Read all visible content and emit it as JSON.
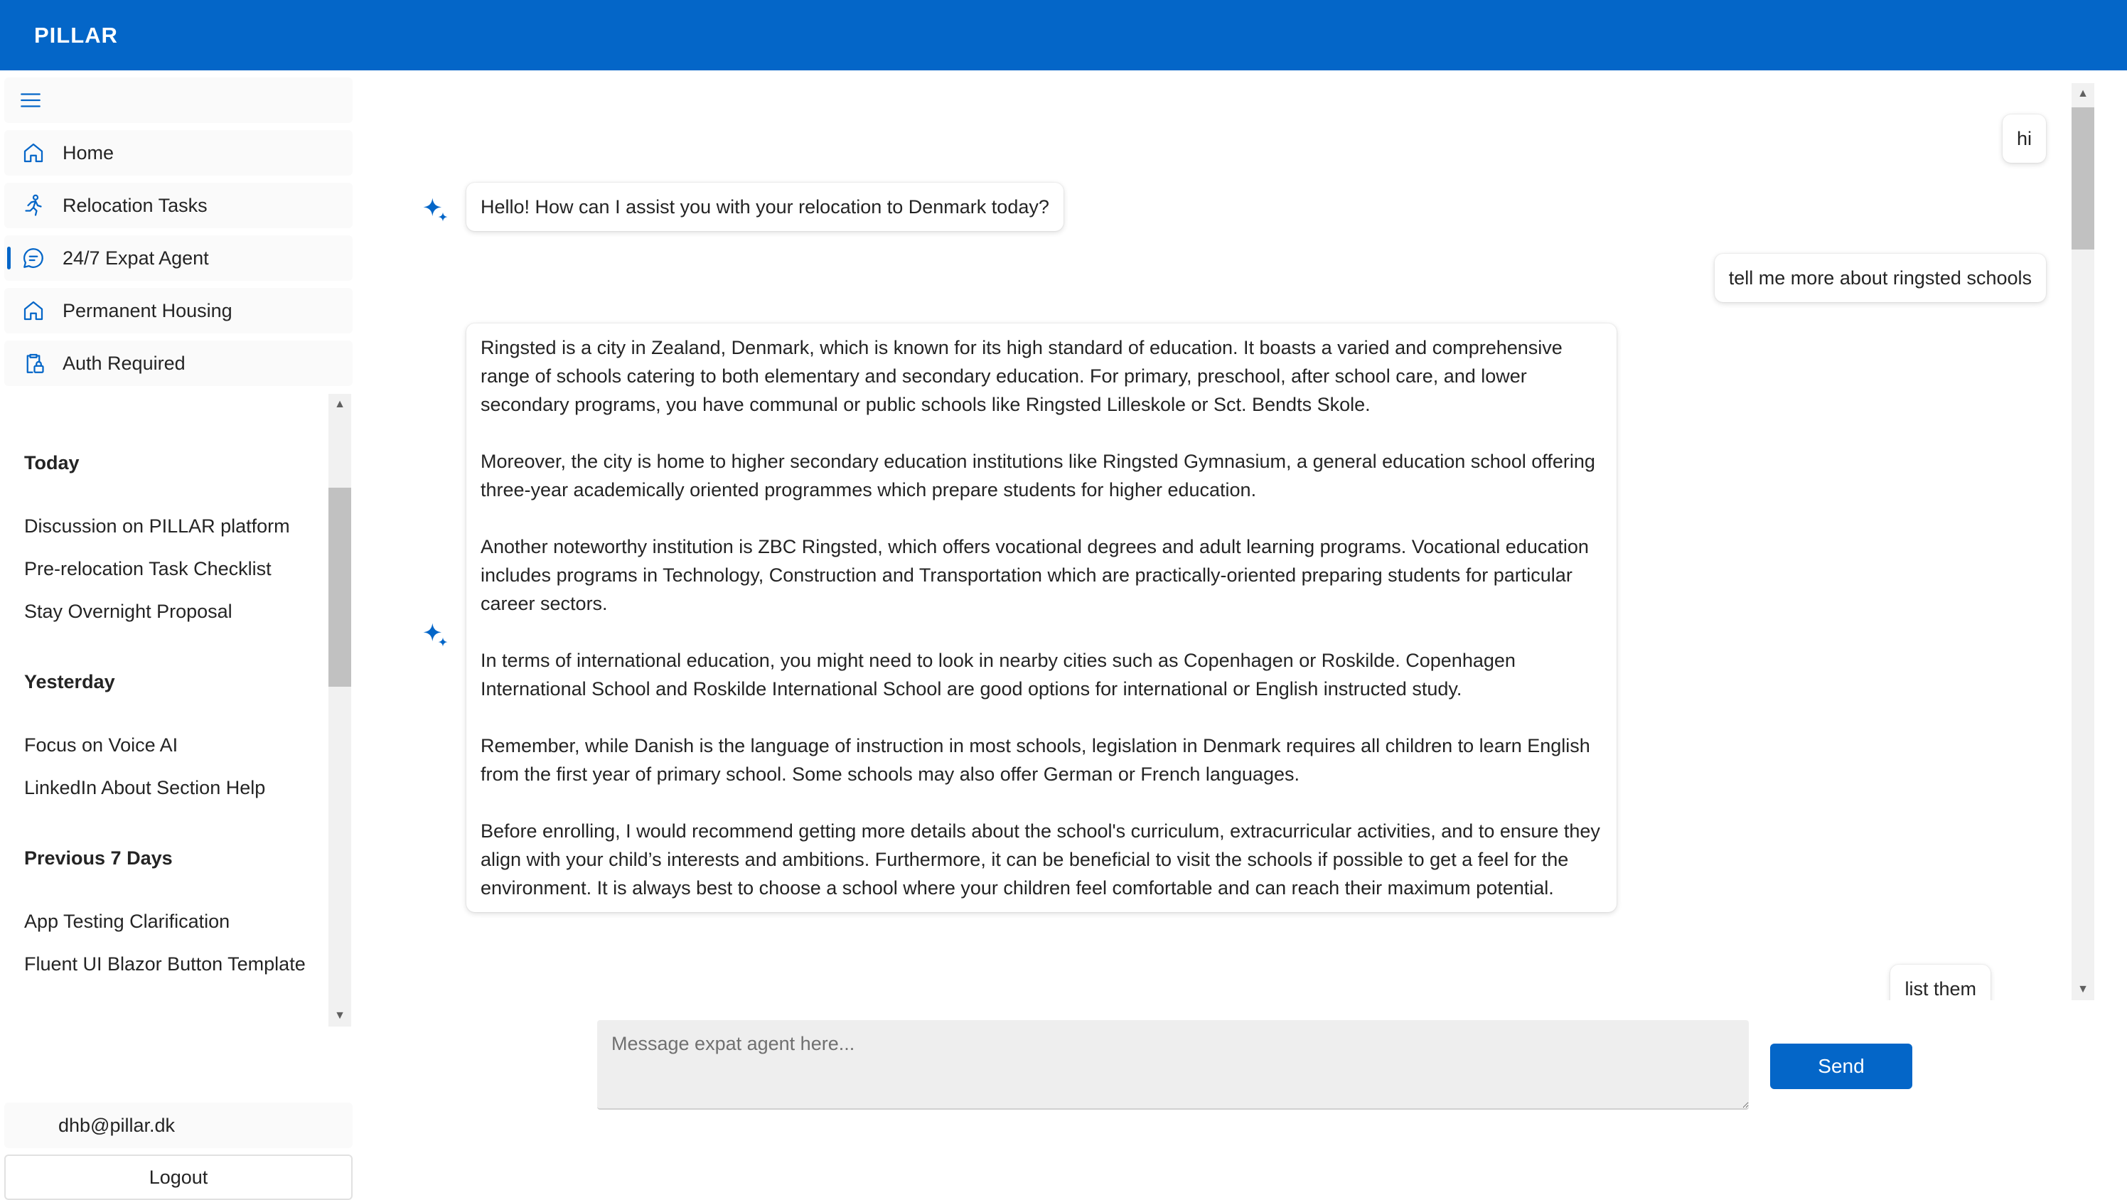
{
  "header": {
    "brand": "PILLAR"
  },
  "sidebar": {
    "menu_icon": "hamburger-menu-icon",
    "items": [
      {
        "label": "Home",
        "icon": "home-icon"
      },
      {
        "label": "Relocation Tasks",
        "icon": "person-running-icon"
      },
      {
        "label": "24/7 Expat Agent",
        "icon": "chat-bubble-icon",
        "active": true
      },
      {
        "label": "Permanent Housing",
        "icon": "home-icon"
      },
      {
        "label": "Auth Required",
        "icon": "clipboard-lock-icon"
      }
    ],
    "history": [
      {
        "group": "Today",
        "items": [
          "Discussion on PILLAR platform",
          "Pre-relocation Task Checklist",
          "Stay Overnight Proposal"
        ]
      },
      {
        "group": "Yesterday",
        "items": [
          "Focus on Voice AI",
          "LinkedIn About Section Help"
        ]
      },
      {
        "group": "Previous 7 Days",
        "items": [
          "App Testing Clarification",
          "Fluent UI Blazor Button Template"
        ]
      }
    ],
    "user_email": "dhb@pillar.dk",
    "logout_label": "Logout"
  },
  "chat": {
    "messages": [
      {
        "role": "user",
        "text": "hi"
      },
      {
        "role": "agent",
        "paragraphs": [
          "Hello! How can I assist you with your relocation to Denmark today?"
        ]
      },
      {
        "role": "user",
        "text": "tell me more about ringsted schools"
      },
      {
        "role": "agent",
        "paragraphs": [
          "Ringsted is a city in Zealand, Denmark, which is known for its high standard of education. It boasts a varied and comprehensive range of schools catering to both elementary and secondary education. For primary, preschool, after school care, and lower secondary programs, you have communal or public schools like Ringsted Lilleskole or Sct. Bendts Skole.",
          "Moreover, the city is home to higher secondary education institutions like Ringsted Gymnasium, a general education school offering three-year academically oriented programmes which prepare students for higher education.",
          "Another noteworthy institution is ZBC Ringsted, which offers vocational degrees and adult learning programs. Vocational education includes programs in Technology, Construction and Transportation which are practically-oriented preparing students for particular career sectors.",
          "In terms of international education, you might need to look in nearby cities such as Copenhagen or Roskilde. Copenhagen International School and Roskilde International School are good options for international or English instructed study.",
          "Remember, while Danish is the language of instruction in most schools, legislation in Denmark requires all children to learn English from the first year of primary school. Some schools may also offer German or French languages.",
          "Before enrolling, I would recommend getting more details about the school's curriculum, extracurricular activities, and to ensure they align with your child’s interests and ambitions. Furthermore, it can be beneficial to visit the schools if possible to get a feel for the environment. It is always best to choose a school where your children feel comfortable and can reach their maximum potential."
        ]
      },
      {
        "role": "user",
        "text": "list them"
      }
    ],
    "composer": {
      "placeholder": "Message expat agent here...",
      "value": ""
    },
    "send_label": "Send",
    "agent_icon": "sparkle-icon"
  },
  "colors": {
    "brand": "#0466c8",
    "header_text": "#ffffff"
  }
}
